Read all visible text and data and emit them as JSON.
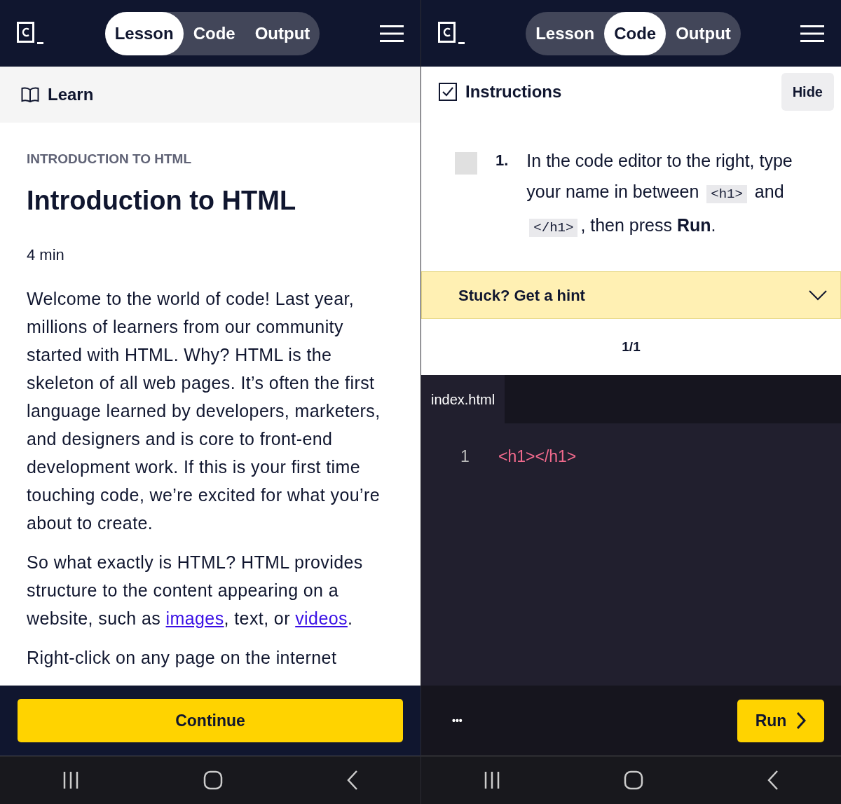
{
  "lesson_screen": {
    "tabs": [
      {
        "label": "Lesson",
        "selected": true
      },
      {
        "label": "Code",
        "selected": false
      },
      {
        "label": "Output",
        "selected": false
      }
    ],
    "section": "Learn",
    "eyebrow": "INTRODUCTION TO HTML",
    "title": "Introduction to HTML",
    "duration": "4 min",
    "paragraphs": [
      [
        {
          "kind": "text",
          "text": "Welcome to the world of code! Last year, millions of learners from our community started with HTML. Why? HTML is the skeleton of all web pages. It’s often the first language learned by developers, marketers, and designers and is core to front-end development work. If this is your first time touching code, we’re excited for what you’re about to create."
        }
      ],
      [
        {
          "kind": "text",
          "text": "So what exactly is HTML? HTML provides structure to the content appearing on a website, such as "
        },
        {
          "kind": "link",
          "text": "images"
        },
        {
          "kind": "text",
          "text": ", text, or "
        },
        {
          "kind": "link",
          "text": "videos"
        },
        {
          "kind": "text",
          "text": "."
        }
      ],
      [
        {
          "kind": "text",
          "text": "Right-click on any page on the internet"
        }
      ]
    ],
    "continue_button": "Continue"
  },
  "code_screen": {
    "tabs": [
      {
        "label": "Lesson",
        "selected": false
      },
      {
        "label": "Code",
        "selected": true
      },
      {
        "label": "Output",
        "selected": false
      }
    ],
    "instructions": {
      "label": "Instructions",
      "checked": true
    },
    "hide_button": "Hide",
    "tasks": [
      {
        "number": "1.",
        "checked": false,
        "parts": [
          {
            "kind": "text",
            "text": "In the code editor to the right, type your name in between "
          },
          {
            "kind": "code",
            "text": "<h1>"
          },
          {
            "kind": "text",
            "text": " and "
          },
          {
            "kind": "code",
            "text": "</h1>"
          },
          {
            "kind": "text",
            "text": ", then press "
          },
          {
            "kind": "bold",
            "text": "Run"
          },
          {
            "kind": "text",
            "text": "."
          }
        ]
      }
    ],
    "hint": {
      "label": "Stuck? Get a hint",
      "expanded": false
    },
    "hint_count": "1/1",
    "editor": {
      "file_tab": "index.html",
      "lines": [
        {
          "number": "1",
          "code": "<h1></h1>"
        }
      ]
    },
    "more_button": "•••",
    "run_button": "Run"
  }
}
